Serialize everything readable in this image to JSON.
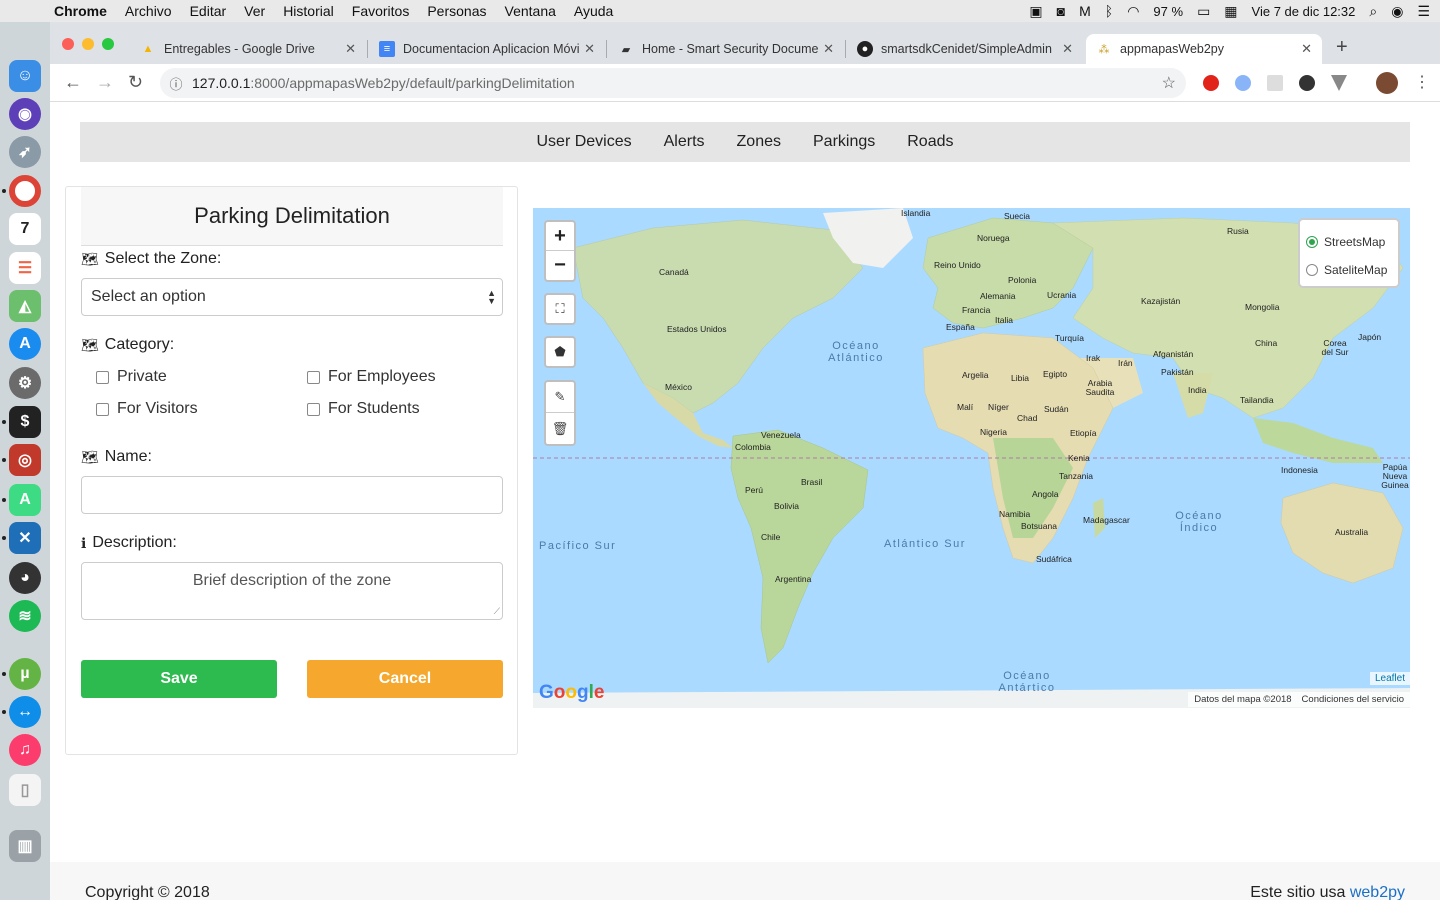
{
  "menubar": {
    "app": "Chrome",
    "items": [
      "Archivo",
      "Editar",
      "Ver",
      "Historial",
      "Favoritos",
      "Personas",
      "Ventana",
      "Ayuda"
    ],
    "battery": "97 %",
    "clock": "Vie 7 de dic  12:32"
  },
  "browser": {
    "tabs": [
      {
        "title": "Entregables - Google Drive"
      },
      {
        "title": "Documentacion Aplicacion Móvil"
      },
      {
        "title": "Home - Smart Security Document"
      },
      {
        "title": "smartsdkCenidet/SimpleAdmin"
      },
      {
        "title": "appmapasWeb2py"
      }
    ],
    "url_host": "127.0.0.1",
    "url_path": ":8000/appmapasWeb2py/default/parkingDelimitation"
  },
  "nav": {
    "items": [
      "User Devices",
      "Alerts",
      "Zones",
      "Parkings",
      "Roads"
    ]
  },
  "form": {
    "title": "Parking Delimitation",
    "zone_label": "Select the Zone:",
    "zone_value": "Select an option",
    "category_label": "Category:",
    "categories": [
      "Private",
      "For Employees",
      "For Visitors",
      "For Students"
    ],
    "name_label": "Name:",
    "name_value": "",
    "description_label": "Description:",
    "description_placeholder": "Brief description of the zone",
    "save_label": "Save",
    "cancel_label": "Cancel"
  },
  "map": {
    "layers": [
      {
        "label": "StreetsMap",
        "selected": true
      },
      {
        "label": "SateliteMap",
        "selected": false
      }
    ],
    "countries": [
      "Islandia",
      "Suecia",
      "Rusia",
      "Noruega",
      "Canadá",
      "Reino Unido",
      "Polonia",
      "Alemania",
      "Ucrania",
      "Kazajistán",
      "Francia",
      "Italia",
      "Mongolia",
      "España",
      "Turquía",
      "Estados Unidos",
      "China",
      "Corea del Sur",
      "Japón",
      "Irak",
      "Irán",
      "Afganistán",
      "Argelia",
      "Libia",
      "Egipto",
      "Pakistán",
      "México",
      "Arabia Saudita",
      "India",
      "Tailandia",
      "Malí",
      "Níger",
      "Chad",
      "Sudán",
      "Venezuela",
      "Colombia",
      "Nigeria",
      "Etiopía",
      "Kenia",
      "Tanzania",
      "Indonesia",
      "Papúa Nueva Guinea",
      "Perú",
      "Brasil",
      "Bolivia",
      "Angola",
      "Namibia",
      "Botsuana",
      "Madagascar",
      "Australia",
      "Chile",
      "Sudáfrica",
      "Argentina"
    ],
    "oceans": [
      "Océano Atlántico",
      "Pacífico Sur",
      "Atlántico Sur",
      "Océano Índico",
      "Océano Antártico"
    ],
    "google": "Google",
    "attribution": [
      "Datos del mapa ©2018",
      "Condiciones del servicio"
    ],
    "leaflet": "Leaflet"
  },
  "footer": {
    "copyright": "Copyright © 2018",
    "powered_prefix": "Este sitio usa ",
    "powered_link": "web2py"
  }
}
